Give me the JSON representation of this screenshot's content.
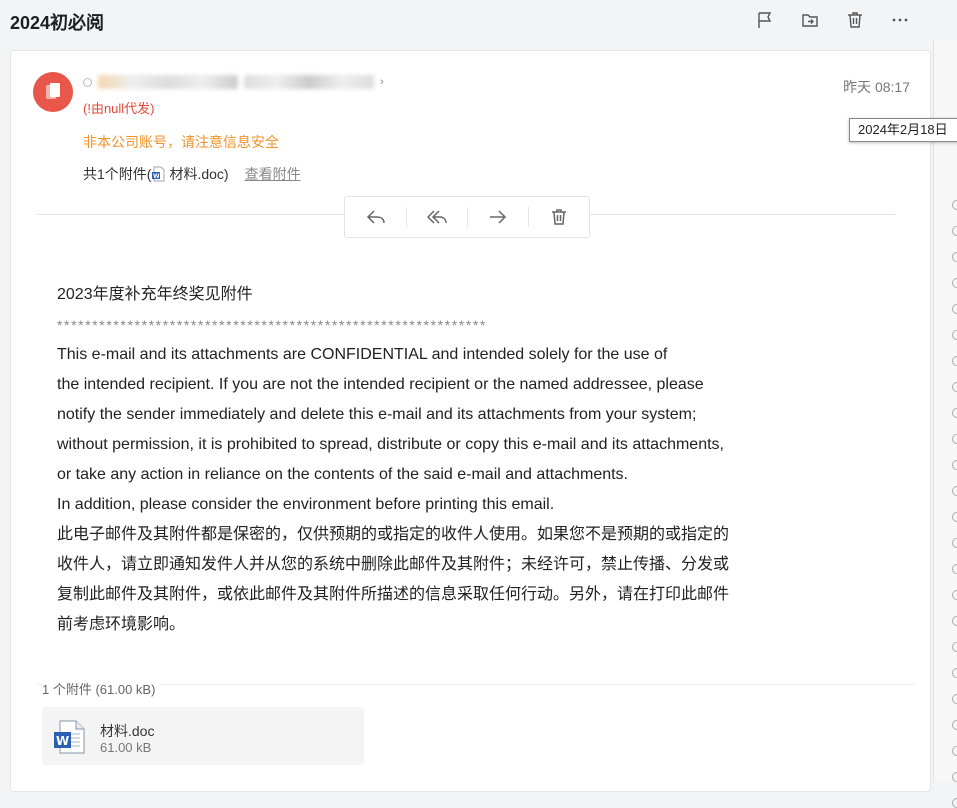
{
  "page": {
    "title": "2024初必阅"
  },
  "toolbar": {
    "icons": [
      "flag-icon",
      "move-to-folder-icon",
      "trash-icon",
      "more-icon"
    ]
  },
  "message": {
    "proxy_note": "(!由null代发)",
    "warning": "非本公司账号，请注意信息安全",
    "attachment_line_prefix": "共1个附件(",
    "attachment_line_name": "材料.doc",
    "attachment_line_suffix": ")",
    "view_attachments": "查看附件",
    "time": "昨天 08:17",
    "time_tooltip": "2024年2月18日"
  },
  "quick_actions": [
    "reply-icon",
    "reply-all-icon",
    "forward-icon",
    "delete-icon"
  ],
  "body": {
    "lines": [
      "2023年度补充年终奖见附件",
      "*************************************************************",
      "This e-mail and its attachments are CONFIDENTIAL and intended solely for the use of",
      "the intended recipient.  If you are not the intended recipient or the named addressee, please",
      "notify the sender immediately and delete this e-mail and its attachments from your system;",
      "without permission, it is prohibited to spread, distribute or copy this e-mail and its attachments,",
      "or take any action in reliance on the contents of the said e-mail and attachments.",
      "In addition, please consider the environment before printing this email.",
      "此电子邮件及其附件都是保密的，仅供预期的或指定的收件人使用。如果您不是预期的或指定的",
      "收件人，请立即通知发件人并从您的系统中删除此邮件及其附件；未经许可，禁止传播、分发或",
      "复制此邮件及其附件，或依此邮件及其附件所描述的信息采取任何行动。另外，请在打印此邮件",
      "前考虑环境影响。"
    ]
  },
  "attachments": {
    "summary": "1 个附件 (61.00 kB)",
    "items": [
      {
        "name": "材料.doc",
        "size": "61.00 kB"
      }
    ]
  },
  "colors": {
    "avatar": "#e9564a",
    "warning": "#f0932b",
    "proxy": "#e24a3b",
    "word_blue": "#2b5fb4"
  }
}
